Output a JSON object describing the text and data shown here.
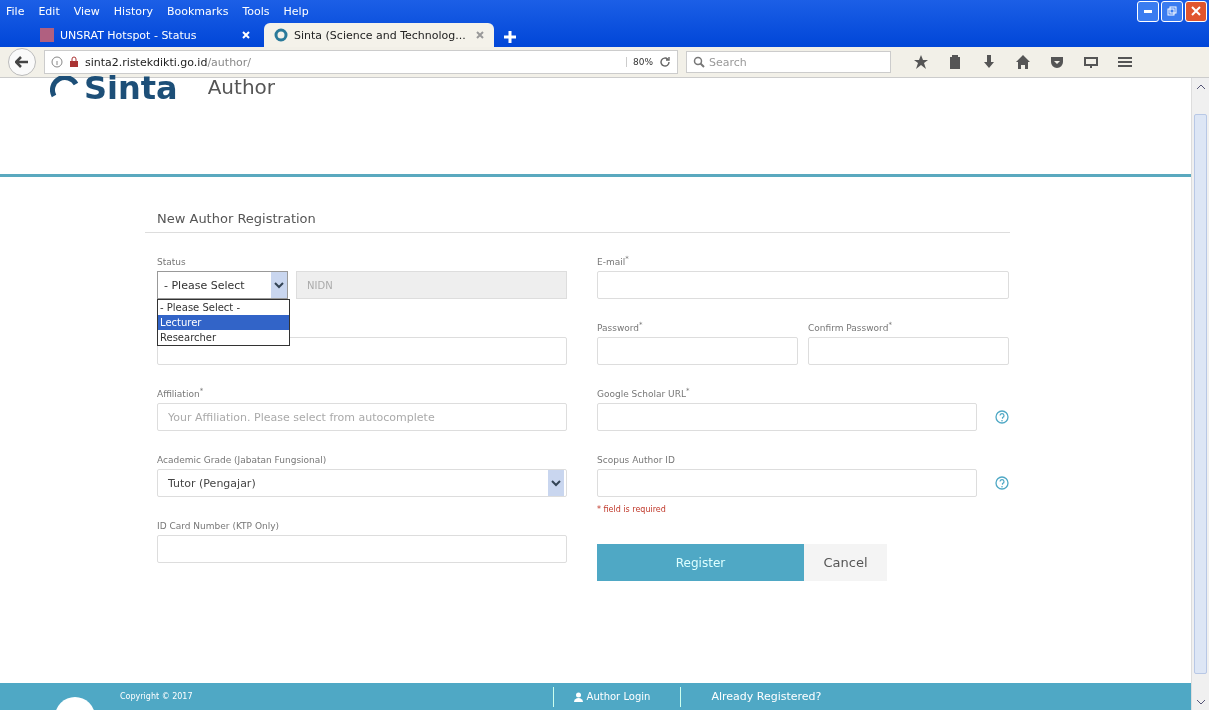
{
  "menu": [
    "File",
    "Edit",
    "View",
    "History",
    "Bookmarks",
    "Tools",
    "Help"
  ],
  "tabs": [
    {
      "label": "UNSRAT Hotspot - Status",
      "selected": false
    },
    {
      "label": "Sinta (Science and Technolog...",
      "selected": true
    }
  ],
  "address": {
    "url_host": "sinta2.ristekdikti.go.id",
    "url_path": "/author/",
    "zoom": "80%",
    "search_placeholder": "Search"
  },
  "header": {
    "logo": "Sinta",
    "title": "Author"
  },
  "form": {
    "title": "New Author Registration",
    "left": [
      {
        "kind": "status",
        "label": "Status",
        "select_value": "- Please Select",
        "nidn_placeholder": "NIDN",
        "options": [
          {
            "label": "- Please Select -",
            "selected": false
          },
          {
            "label": "Lecturer",
            "selected": true
          },
          {
            "label": "Researcher",
            "selected": false
          }
        ]
      },
      {
        "kind": "input"
      },
      {
        "kind": "input",
        "label": "Affiliation$^{*}$",
        "placeholder": "Your Affiliation. Please select from autocomplete"
      },
      {
        "kind": "select",
        "label": "Academic Grade (Jabatan Fungsional)",
        "value": "Tutor (Pengajar)"
      },
      {
        "kind": "input",
        "label": "ID Card Number (KTP Only)"
      }
    ],
    "right": [
      {
        "kind": "input",
        "label": "E-mail$^{*}$"
      },
      {
        "kind": "pair",
        "label": "Password$^{*}$",
        "label2": "Confirm Password$^{*}$"
      },
      {
        "kind": "help",
        "label": "Google Scholar URL$^{*}$"
      },
      {
        "kind": "help",
        "label": "Scopus Author ID"
      }
    ],
    "note": "* field is required",
    "buttons": [
      {
        "label": "Register",
        "kind": "primary"
      },
      {
        "label": "Cancel",
        "kind": "secondary"
      }
    ]
  },
  "footer": {
    "copyright": "Copyright © 2017",
    "login": "Author Login",
    "registered": "Already Registered?"
  }
}
